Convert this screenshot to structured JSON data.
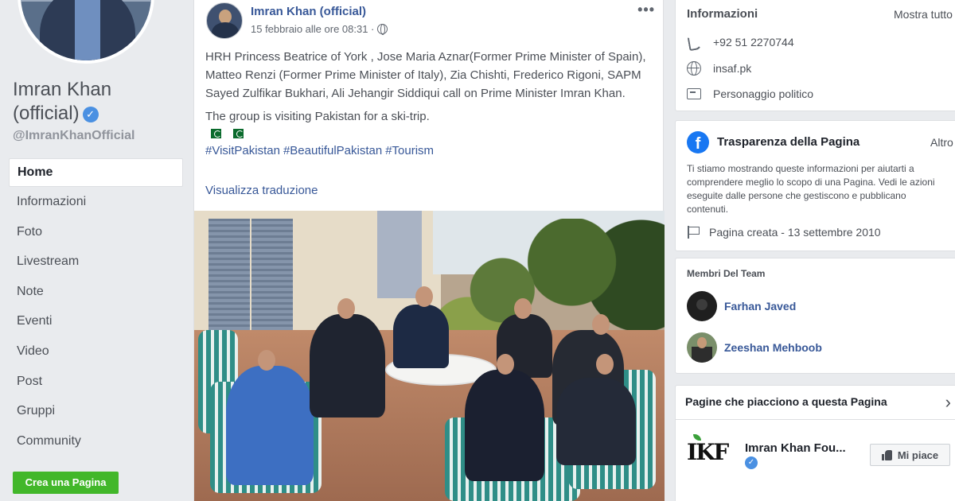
{
  "sidebar": {
    "page_name": "Imran Khan (official)",
    "verified_mark": "✓",
    "handle": "@ImranKhanOfficial",
    "nav": [
      {
        "label": "Home",
        "active": true
      },
      {
        "label": "Informazioni"
      },
      {
        "label": "Foto"
      },
      {
        "label": "Livestream"
      },
      {
        "label": "Note"
      },
      {
        "label": "Eventi"
      },
      {
        "label": "Video"
      },
      {
        "label": "Post"
      },
      {
        "label": "Gruppi"
      },
      {
        "label": "Community"
      }
    ],
    "create_page_label": "Crea una Pagina"
  },
  "post": {
    "author": "Imran Khan (official)",
    "date": "15 febbraio alle ore 08:31 ·",
    "more": "•••",
    "text_1": "HRH Princess Beatrice of York , Jose Maria Aznar(Former Prime Minister of Spain), Matteo Renzi (Former Prime Minister of Italy), Zia Chishti, Frederico Rigoni, SAPM Sayed Zulfikar Bukhari, Ali Jehangir Siddiqui call on Prime Minister Imran Khan.",
    "text_2": "The group is visiting Pakistan for a ski-trip.",
    "hashtags": [
      "#VisitPakistan",
      "#BeautifulPakistan",
      "#Tourism"
    ],
    "translate": "Visualizza traduzione"
  },
  "info_card": {
    "title": "Informazioni",
    "show_all": "Mostra tutto",
    "phone": "+92 51 2270744",
    "website": "insaf.pk",
    "category": "Personaggio politico"
  },
  "transparency_card": {
    "title": "Trasparenza della Pagina",
    "more": "Altro",
    "description": "Ti stiamo mostrando queste informazioni per aiutarti a comprendere meglio lo scopo di una Pagina. Vedi le azioni eseguite dalle persone che gestiscono e pubblicano contenuti.",
    "created": "Pagina creata - 13 settembre 2010",
    "fb_glyph": "f"
  },
  "team_card": {
    "title": "Membri Del Team",
    "members": [
      "Farhan Javed",
      "Zeeshan Mehboob"
    ]
  },
  "liked_pages_card": {
    "title": "Pagine che piacciono a questa Pagina",
    "page_name": "Imran Khan Fou...",
    "logo_text": "IKF",
    "like_label": "Mi piace",
    "chevron": "›"
  },
  "colors": {
    "link_blue": "#385898",
    "facebook_blue": "#1877f2",
    "create_green": "#42b72a",
    "background": "#e9ebee"
  }
}
